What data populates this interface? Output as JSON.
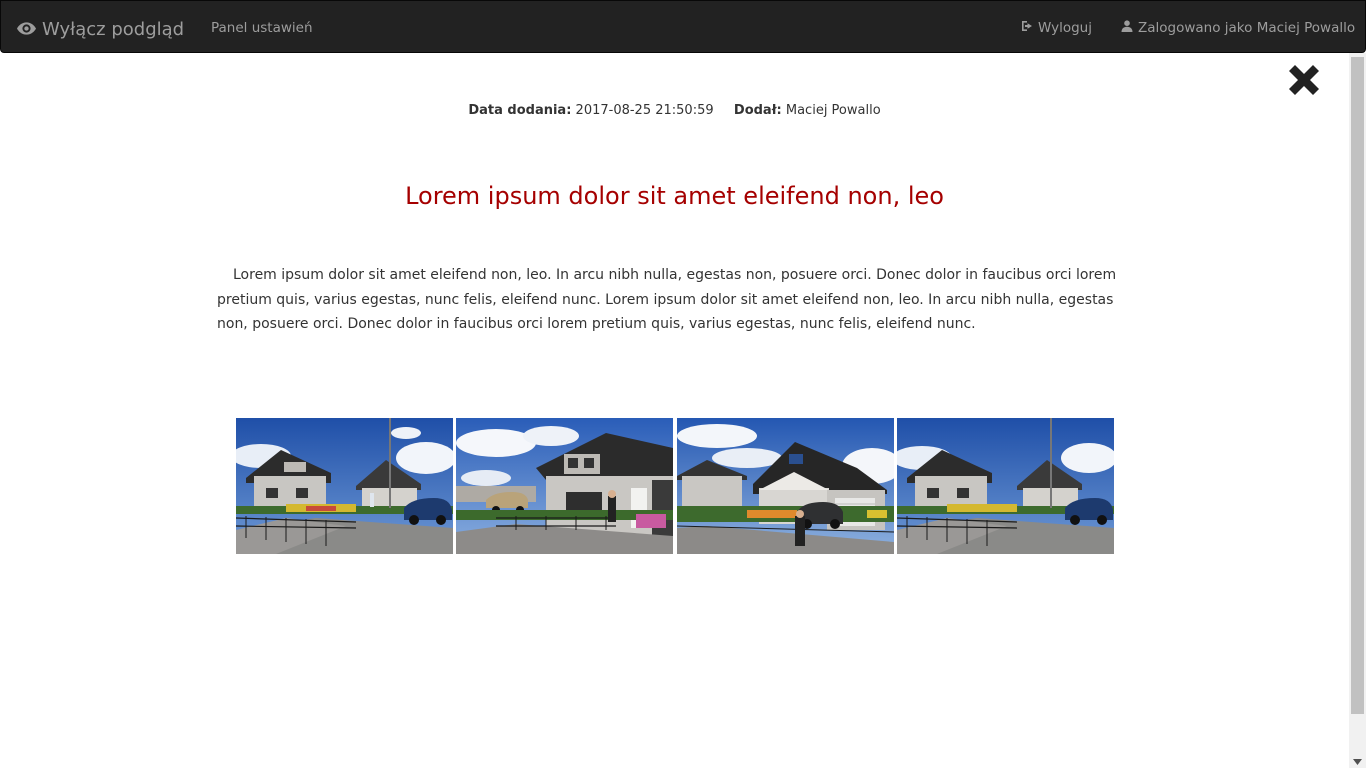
{
  "navbar": {
    "brand_label": "Wyłącz podgląd",
    "brand_icon": "eye-icon",
    "settings_label": "Panel ustawień",
    "logout_label": "Wyloguj",
    "logout_icon": "log-out-icon",
    "user_label": "Zalogowano jako Maciej Powallo",
    "user_icon": "user-icon"
  },
  "article": {
    "date_label": "Data dodania:",
    "date_value": "2017-08-25 21:50:59",
    "author_label": "Dodał:",
    "author_value": "Maciej Powallo",
    "title": "Lorem ipsum dolor sit amet eleifend non, leo",
    "body": "Lorem ipsum dolor sit amet eleifend non, leo. In arcu nibh nulla, egestas non, posuere orci. Donec dolor in faucibus orci lorem pretium quis, varius egestas, nunc felis, eleifend nunc. Lorem ipsum dolor sit amet eleifend non, leo. In arcu nibh nulla, egestas non, posuere orci. Donec dolor in faucibus orci lorem pretium quis, varius egestas, nunc felis, eleifend nunc."
  },
  "close_icon": "close-icon",
  "gallery": {
    "items": [
      {
        "icon": "house-rendering-image-1"
      },
      {
        "icon": "house-rendering-image-2"
      },
      {
        "icon": "house-rendering-image-3"
      },
      {
        "icon": "house-rendering-image-4"
      }
    ]
  },
  "colors": {
    "navbar_bg": "#222222",
    "nav_text": "#9d9d9d",
    "title": "#a50000",
    "text": "#333333"
  }
}
